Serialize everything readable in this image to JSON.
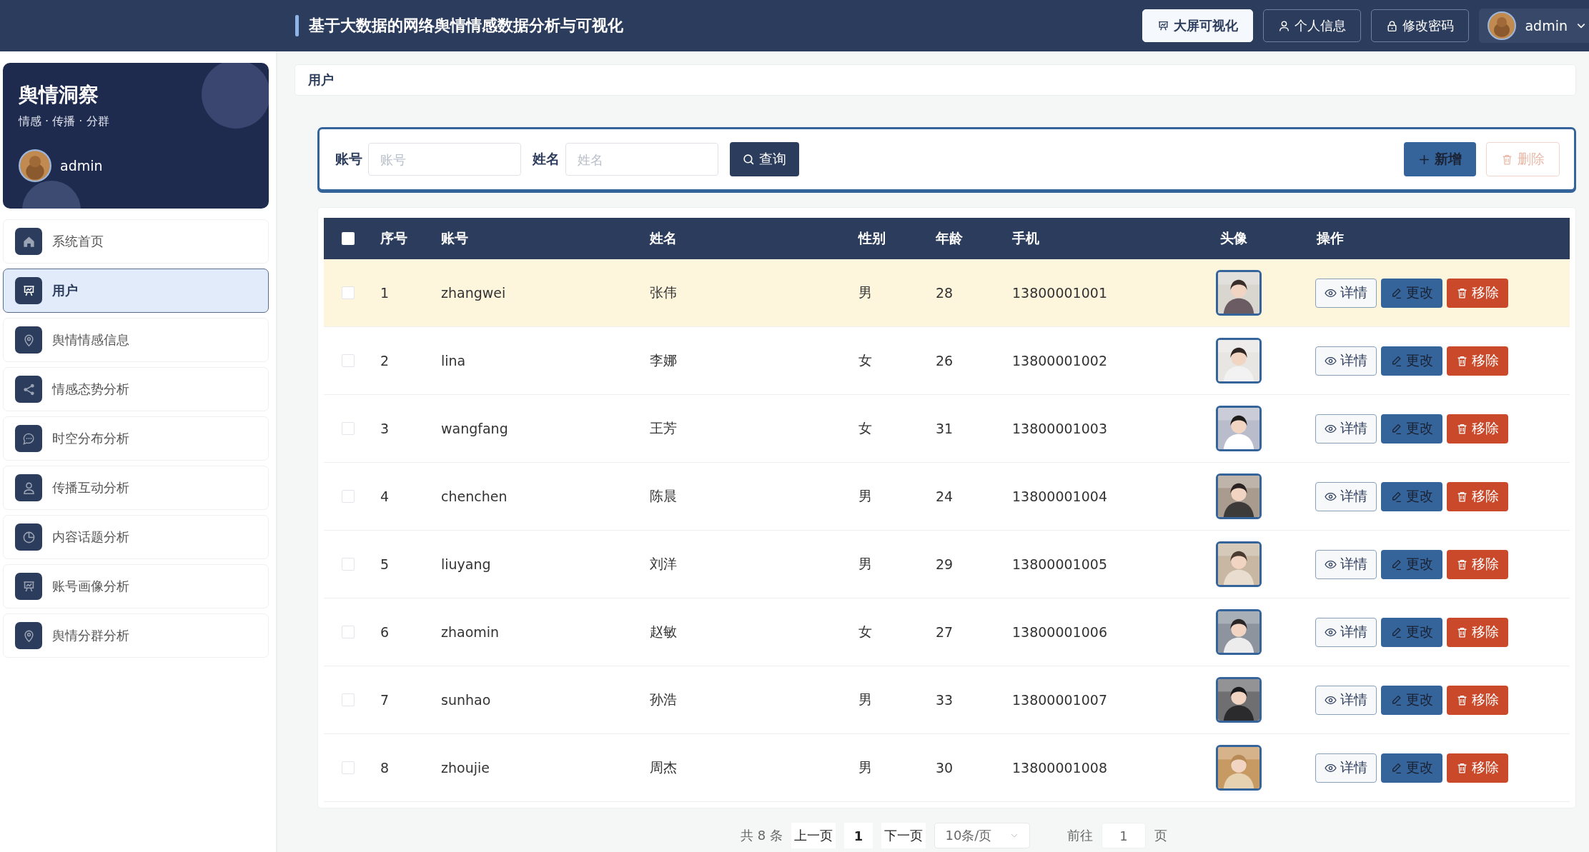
{
  "header": {
    "title": "基于大数据的网络舆情情感数据分析与可视化",
    "buttons": [
      {
        "label": "大屏可视化",
        "selected": true
      },
      {
        "label": "个人信息",
        "selected": false
      },
      {
        "label": "修改密码",
        "selected": false
      }
    ],
    "user": "admin"
  },
  "sidebar": {
    "brand": "舆情洞察",
    "tagline": "情感 · 传播 · 分群",
    "user": "admin",
    "items": [
      {
        "label": "系统首页",
        "selected": false
      },
      {
        "label": "用户",
        "selected": true
      },
      {
        "label": "舆情情感信息",
        "selected": false
      },
      {
        "label": "情感态势分析",
        "selected": false
      },
      {
        "label": "时空分布分析",
        "selected": false
      },
      {
        "label": "传播互动分析",
        "selected": false
      },
      {
        "label": "内容话题分析",
        "selected": false
      },
      {
        "label": "账号画像分析",
        "selected": false
      },
      {
        "label": "舆情分群分析",
        "selected": false
      }
    ]
  },
  "breadcrumb": "用户",
  "search": {
    "fields": [
      {
        "label": "账号",
        "placeholder": "账号"
      },
      {
        "label": "姓名",
        "placeholder": "姓名"
      }
    ],
    "query_button": "查询",
    "add_button": "新增",
    "delete_button": {
      "label": "删除",
      "disabled": true
    }
  },
  "table": {
    "all_checked": false,
    "columns": [
      "序号",
      "账号",
      "姓名",
      "性别",
      "年龄",
      "手机",
      "头像",
      "操作"
    ],
    "rows": [
      {
        "checked": false,
        "highlighted": true,
        "cells": [
          "1",
          "zhangwei",
          "张伟",
          "男",
          "28",
          "13800001001"
        ],
        "actions": [
          "详情",
          "更改",
          "移除"
        ]
      },
      {
        "checked": false,
        "highlighted": false,
        "cells": [
          "2",
          "lina",
          "李娜",
          "女",
          "26",
          "13800001002"
        ],
        "actions": [
          "详情",
          "更改",
          "移除"
        ]
      },
      {
        "checked": false,
        "highlighted": false,
        "cells": [
          "3",
          "wangfang",
          "王芳",
          "女",
          "31",
          "13800001003"
        ],
        "actions": [
          "详情",
          "更改",
          "移除"
        ]
      },
      {
        "checked": false,
        "highlighted": false,
        "cells": [
          "4",
          "chenchen",
          "陈晨",
          "男",
          "24",
          "13800001004"
        ],
        "actions": [
          "详情",
          "更改",
          "移除"
        ]
      },
      {
        "checked": false,
        "highlighted": false,
        "cells": [
          "5",
          "liuyang",
          "刘洋",
          "男",
          "29",
          "13800001005"
        ],
        "actions": [
          "详情",
          "更改",
          "移除"
        ]
      },
      {
        "checked": false,
        "highlighted": false,
        "cells": [
          "6",
          "zhaomin",
          "赵敏",
          "女",
          "27",
          "13800001006"
        ],
        "actions": [
          "详情",
          "更改",
          "移除"
        ]
      },
      {
        "checked": false,
        "highlighted": false,
        "cells": [
          "7",
          "sunhao",
          "孙浩",
          "男",
          "33",
          "13800001007"
        ],
        "actions": [
          "详情",
          "更改",
          "移除"
        ]
      },
      {
        "checked": false,
        "highlighted": false,
        "cells": [
          "8",
          "zhoujie",
          "周杰",
          "男",
          "30",
          "13800001008"
        ],
        "actions": [
          "详情",
          "更改",
          "移除"
        ]
      }
    ]
  },
  "pagination": {
    "total": "共 8 条",
    "prev": "上一页",
    "page": "1",
    "next": "下一页",
    "page_size": "10条/页",
    "goto": "前往",
    "goto_value": "1",
    "page_unit": "页"
  }
}
